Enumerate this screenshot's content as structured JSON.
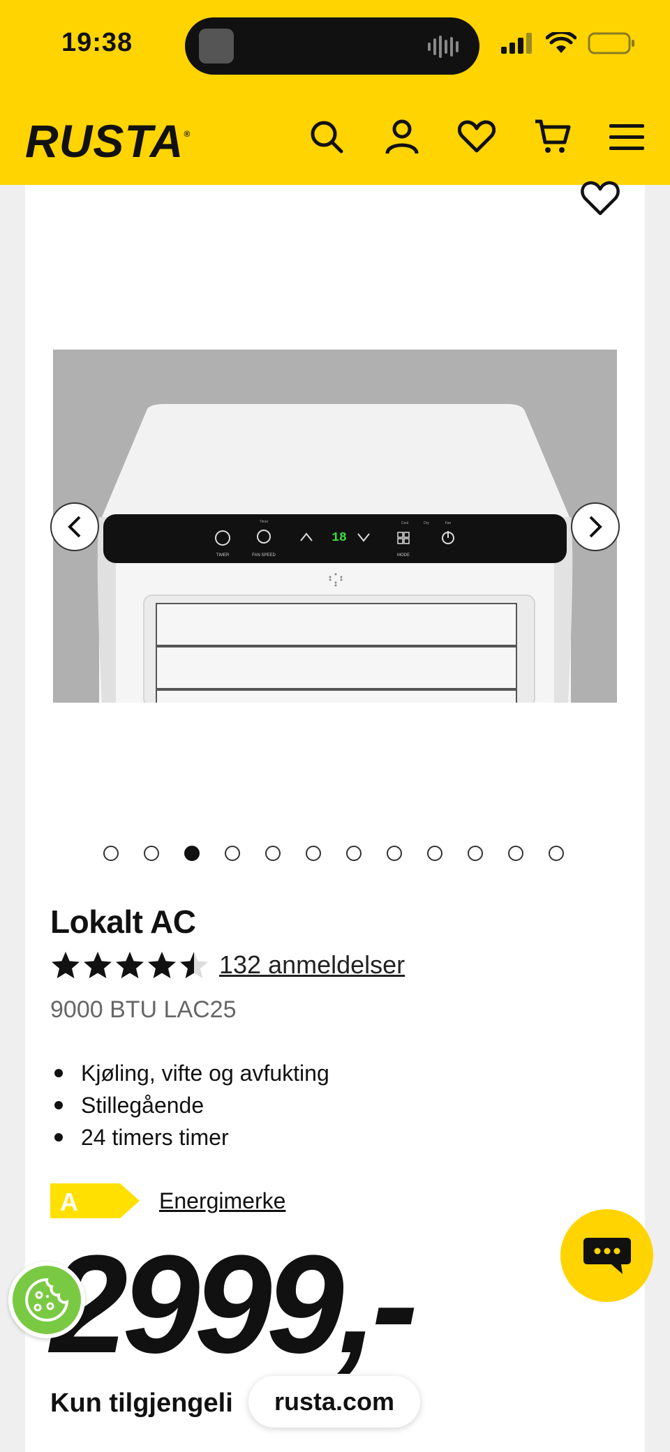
{
  "status_bar": {
    "time": "19:38"
  },
  "header": {
    "logo": "RUSTA",
    "icons": [
      "search-icon",
      "account-icon",
      "favorites-icon",
      "cart-icon",
      "menu-icon"
    ],
    "brand_color": "#ffd400"
  },
  "gallery": {
    "display_reading": "18",
    "total_images": 12,
    "active_index": 3,
    "panel_labels": {
      "timer": "TIMER",
      "fan_speed": "FAN SPEED",
      "mode": "MODE",
      "cool": "Cool",
      "dry": "Dry",
      "fan": "Fan",
      "timer_top": "Timer"
    }
  },
  "product": {
    "title": "Lokalt AC",
    "rating": 4.5,
    "reviews": "132 anmeldelser",
    "subtitle": "9000 BTU LAC25",
    "features": [
      "Kjøling, vifte og avfukting",
      "Stillegående",
      "24 timers timer"
    ],
    "energy_class": "A",
    "energy_link": "Energimerke",
    "energy_color": "#ffe000",
    "price": "2999,-",
    "availability": "Kun tilgjengeli"
  },
  "browser": {
    "url": "rusta.com"
  }
}
